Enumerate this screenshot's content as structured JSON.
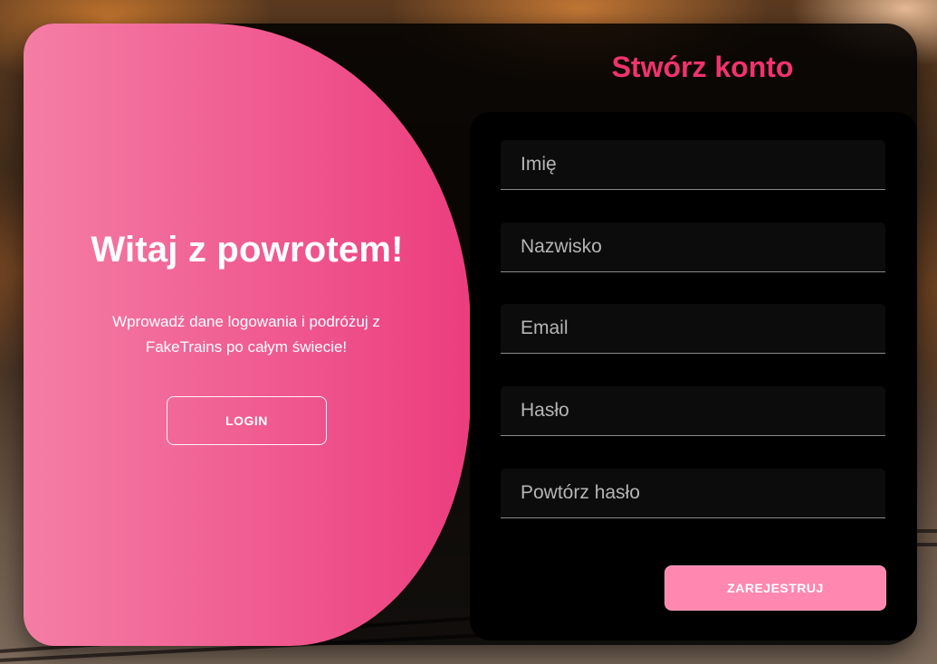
{
  "welcome": {
    "title": "Witaj z powrotem!",
    "text": "Wprowadź dane logowania i podróżuj z FakeTrains po całym świecie!",
    "login_label": "LOGIN"
  },
  "register": {
    "title": "Stwórz konto",
    "fields": [
      {
        "placeholder": "Imię",
        "value": ""
      },
      {
        "placeholder": "Nazwisko",
        "value": ""
      },
      {
        "placeholder": "Email",
        "value": ""
      },
      {
        "placeholder": "Hasło",
        "value": ""
      },
      {
        "placeholder": "Powtórz hasło",
        "value": ""
      }
    ],
    "submit_label": "ZAREJESTRUJ"
  },
  "colors": {
    "accent": "#f0336d",
    "panel_gradient_start": "#f47ea5",
    "panel_gradient_end": "#ec3d7e",
    "submit_button": "#ff87b0",
    "card_background": "#000000"
  }
}
